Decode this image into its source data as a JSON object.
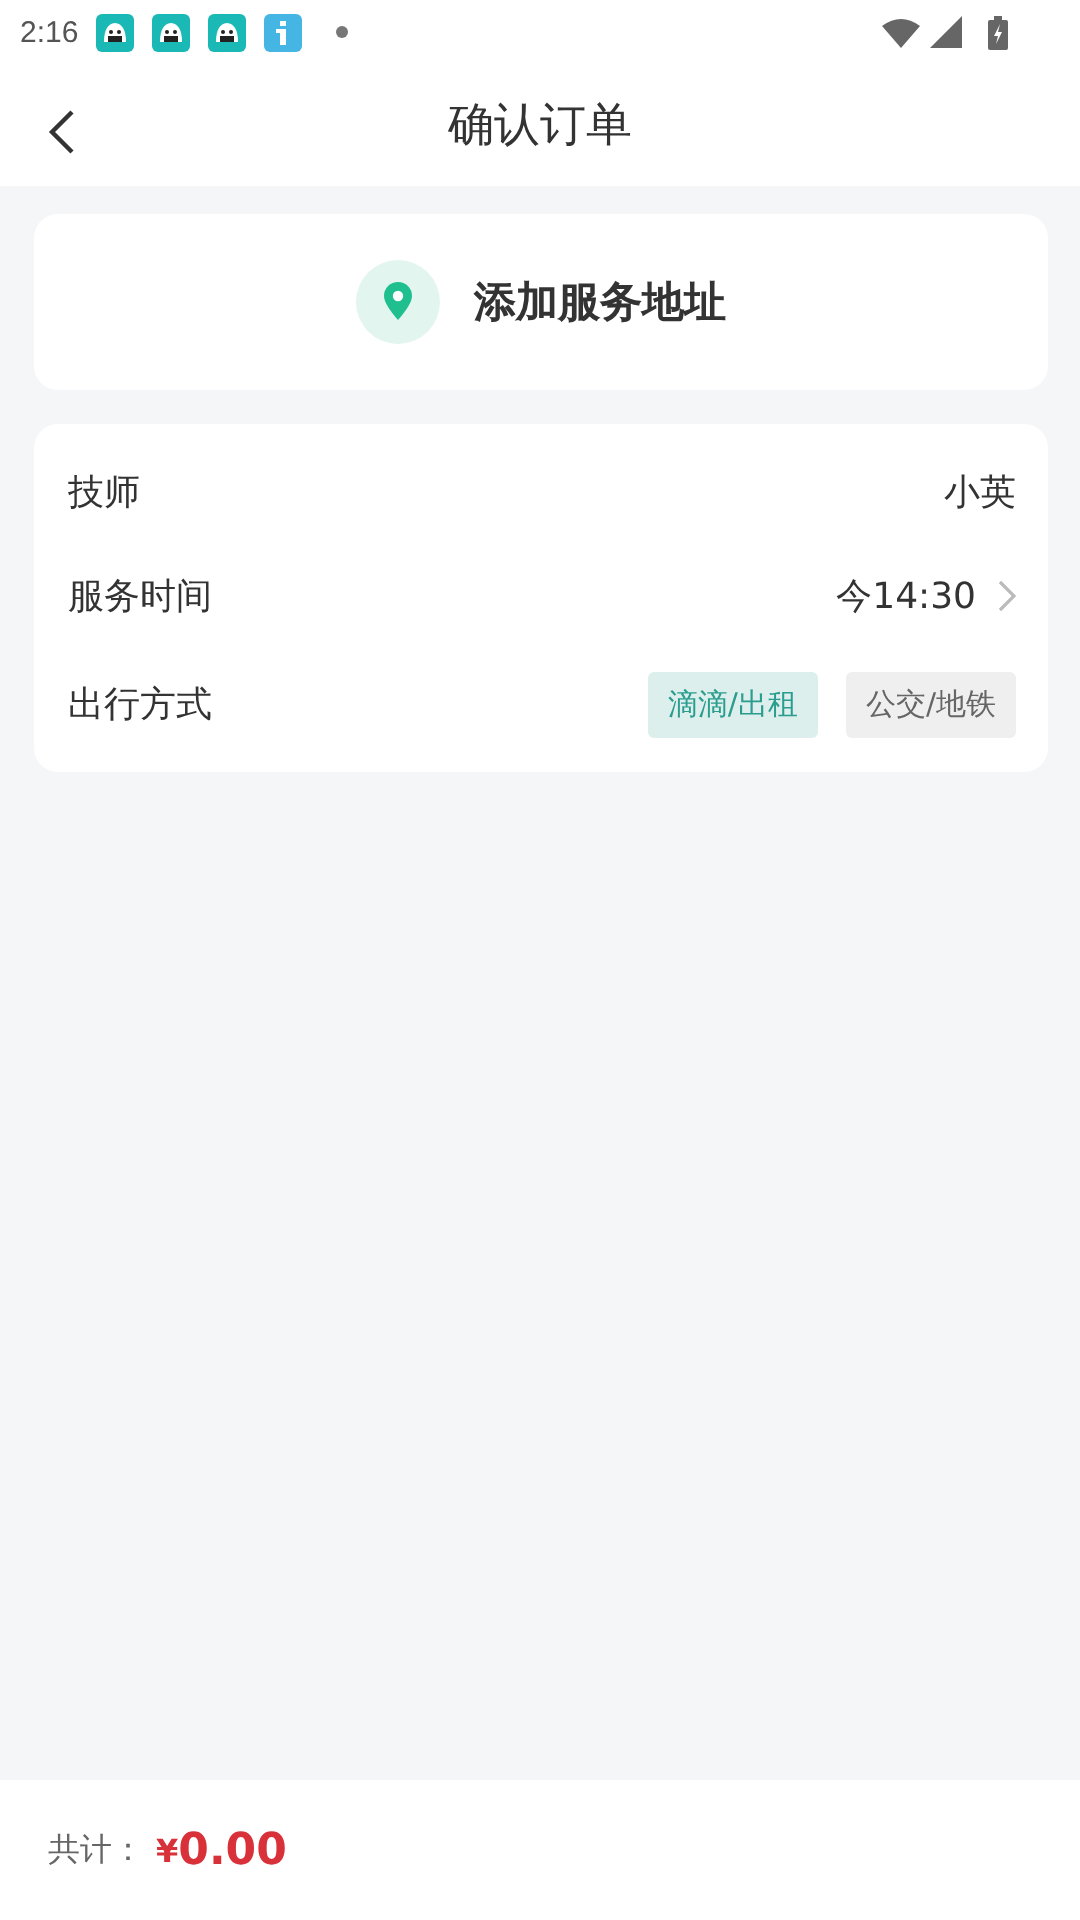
{
  "status_bar": {
    "time": "2:16",
    "notification_icons": [
      {
        "kind": "app"
      },
      {
        "kind": "app"
      },
      {
        "kind": "app"
      },
      {
        "kind": "info"
      }
    ]
  },
  "header": {
    "title": "确认订单"
  },
  "address_card": {
    "label": "添加服务地址"
  },
  "details": [
    {
      "kind": "text",
      "label": "技师",
      "value": "小英"
    },
    {
      "kind": "link",
      "label": "服务时间",
      "value": "今14:30"
    },
    {
      "kind": "options",
      "label": "出行方式",
      "options": [
        {
          "label": "滴滴/出租",
          "selected": true
        },
        {
          "label": "公交/地铁",
          "selected": false
        }
      ]
    }
  ],
  "footer": {
    "total_label": "共计：",
    "currency": "¥",
    "amount": "0.00"
  }
}
